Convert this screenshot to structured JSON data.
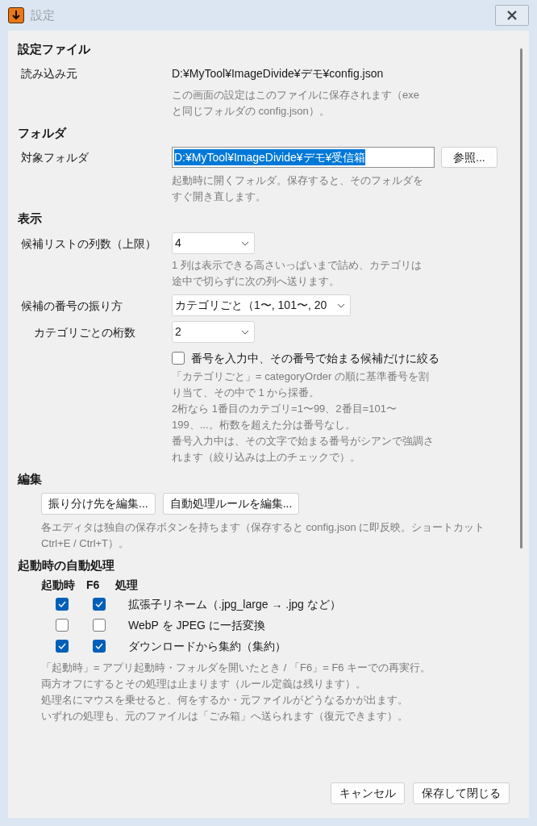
{
  "window": {
    "title": "設定"
  },
  "sections": [
    {
      "kind": "file",
      "heading": "設定ファイル",
      "label": "読み込み元",
      "value": "D:¥MyTool¥ImageDivide¥デモ¥config.json",
      "help": [
        "この画面の設定はこのファイルに保存されます（exe と同じフォルダの config.json）。"
      ]
    },
    {
      "kind": "folder",
      "heading": "フォルダ",
      "label": "対象フォルダ",
      "value": "D:¥MyTool¥ImageDivide¥デモ¥受信箱",
      "text_selected": true,
      "button": "参照...",
      "help": [
        "起動時に開くフォルダ。保存すると、そのフォルダをすぐ開き直します。"
      ]
    },
    {
      "kind": "display",
      "heading": "表示",
      "rows": [
        {
          "kind": "select",
          "label": "候補リストの列数（上限）",
          "value": "4",
          "wide": false,
          "indent": false,
          "help": [
            "1 列は表示できる高さいっぱいまで詰め、カテゴリは途中で切らずに次の列へ送ります。"
          ]
        },
        {
          "kind": "select",
          "label": "候補の番号の振り方",
          "value": "カテゴリごと（1〜, 101〜, 20",
          "wide": true,
          "indent": false
        },
        {
          "kind": "select",
          "label": "カテゴリごとの桁数",
          "value": "2",
          "wide": false,
          "indent": true
        },
        {
          "kind": "checkbox",
          "label": "番号を入力中、その番号で始まる候補だけに絞る",
          "checked": false,
          "help": [
            "「カテゴリごと」= categoryOrder の順に基準番号を割り当て、その中で 1 から採番。",
            "2桁なら 1番目のカテゴリ=1〜99、2番目=101〜199、...。桁数を超えた分は番号なし。",
            "番号入力中は、その文字で始まる番号がシアンで強調されます（絞り込みは上のチェックで）。"
          ]
        }
      ]
    },
    {
      "kind": "edit",
      "heading": "編集",
      "buttons": [
        "振り分け先を編集...",
        "自動処理ルールを編集..."
      ],
      "help": [
        "各エディタは独自の保存ボタンを持ちます（保存すると config.json に即反映。ショートカット Ctrl+E / Ctrl+T）。"
      ]
    },
    {
      "kind": "auto",
      "heading": "起動時の自動処理",
      "columns": [
        "起動時",
        "F6",
        "処理"
      ],
      "rows": [
        {
          "on_start": true,
          "on_f6": true,
          "label": "拡張子リネーム（.jpg_large → .jpg など）"
        },
        {
          "on_start": false,
          "on_f6": false,
          "label": "WebP を JPEG に一括変換"
        },
        {
          "on_start": true,
          "on_f6": true,
          "label": "ダウンロードから集約（集約）"
        }
      ],
      "help": [
        "「起動時」= アプリ起動時・フォルダを開いたとき / 「F6」= F6 キーでの再実行。",
        "両方オフにするとその処理は止まります（ルール定義は残ります）。",
        "処理名にマウスを乗せると、何をするか・元ファイルがどうなるかが出ます。",
        "いずれの処理も、元のファイルは「ごみ箱」へ送られます（復元できます）。"
      ]
    }
  ],
  "footer": {
    "buttons": [
      "キャンセル",
      "保存して閉じる"
    ]
  }
}
